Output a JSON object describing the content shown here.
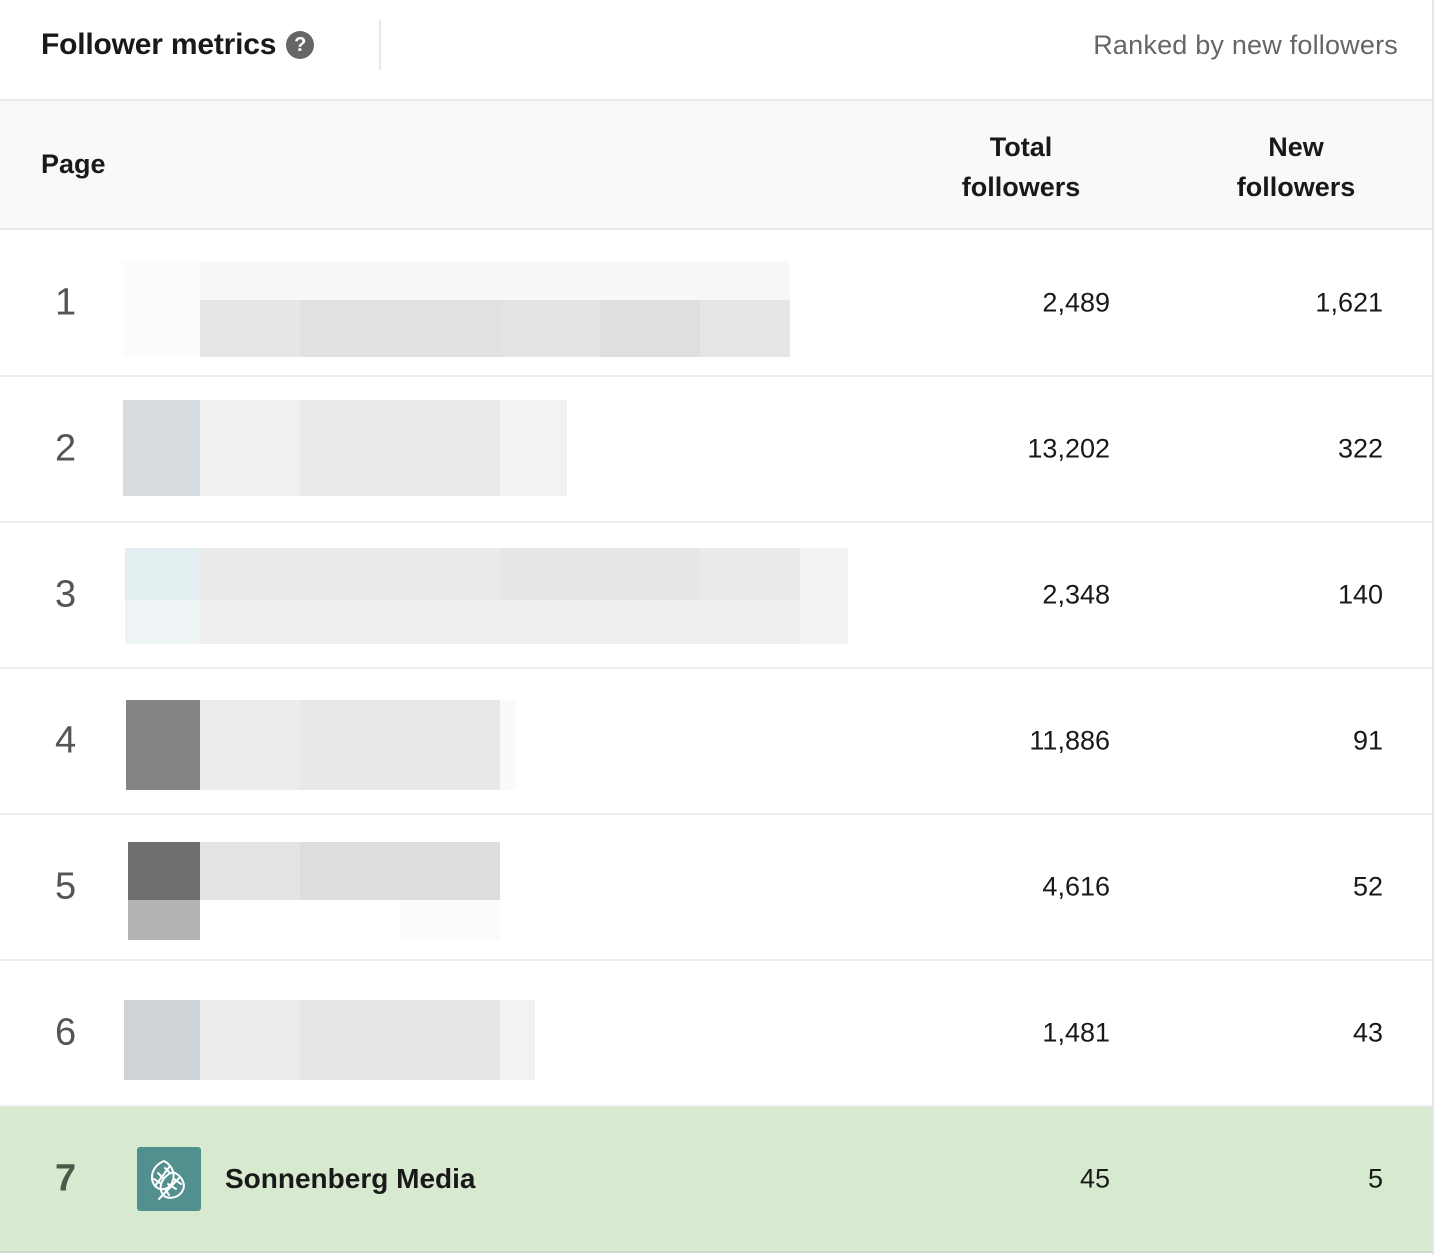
{
  "header": {
    "title": "Follower metrics",
    "help_icon": "question-circle-icon",
    "ranking_note": "Ranked by new followers"
  },
  "table": {
    "columns": {
      "page": "Page",
      "total_followers": "Total followers",
      "new_followers": "New followers"
    },
    "rows": [
      {
        "rank": "1",
        "page_name": "",
        "redacted": true,
        "total_followers": "2,489",
        "new_followers": "1,621"
      },
      {
        "rank": "2",
        "page_name": "",
        "redacted": true,
        "total_followers": "13,202",
        "new_followers": "322"
      },
      {
        "rank": "3",
        "page_name": "",
        "redacted": true,
        "total_followers": "2,348",
        "new_followers": "140"
      },
      {
        "rank": "4",
        "page_name": "",
        "redacted": true,
        "total_followers": "11,886",
        "new_followers": "91"
      },
      {
        "rank": "5",
        "page_name": "",
        "redacted": true,
        "total_followers": "4,616",
        "new_followers": "52"
      },
      {
        "rank": "6",
        "page_name": "",
        "redacted": true,
        "total_followers": "1,481",
        "new_followers": "43"
      },
      {
        "rank": "7",
        "page_name": "Sonnenberg Media",
        "redacted": false,
        "logo_icon": "leaves-logo-icon",
        "total_followers": "45",
        "new_followers": "5",
        "highlighted": true
      }
    ]
  },
  "colors": {
    "highlight_row": "#d7ead0",
    "header_bg": "#f8f9fa",
    "logo_bg": "#52908f",
    "muted_text": "#666666"
  }
}
